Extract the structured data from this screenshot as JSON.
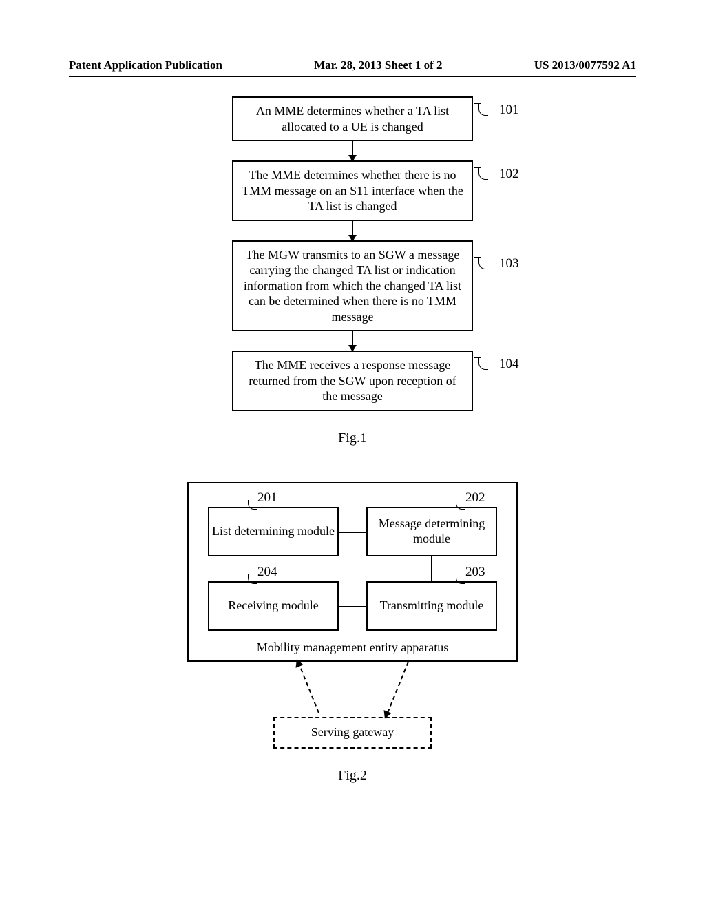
{
  "header": {
    "left": "Patent Application Publication",
    "center": "Mar. 28, 2013  Sheet 1 of 2",
    "right": "US 2013/0077592 A1"
  },
  "fig1": {
    "steps": [
      {
        "num": "101",
        "text": "An MME determines whether a TA list allocated to a UE is changed"
      },
      {
        "num": "102",
        "text": "The MME determines whether there is no TMM message on an S11 interface when the TA list is changed"
      },
      {
        "num": "103",
        "text": "The MGW transmits to an SGW a message carrying the changed TA list or indication information from which the changed TA list can be determined when there is no TMM message"
      },
      {
        "num": "104",
        "text": "The MME receives a response message returned from the SGW upon reception of the message"
      }
    ],
    "caption": "Fig.1"
  },
  "fig2": {
    "modules": [
      {
        "num": "201",
        "text": "List determining module"
      },
      {
        "num": "202",
        "text": "Message determining module"
      },
      {
        "num": "204",
        "text": "Receiving module"
      },
      {
        "num": "203",
        "text": "Transmitting module"
      }
    ],
    "mme_label": "Mobility management entity apparatus",
    "sgw_label": "Serving gateway",
    "caption": "Fig.2"
  }
}
